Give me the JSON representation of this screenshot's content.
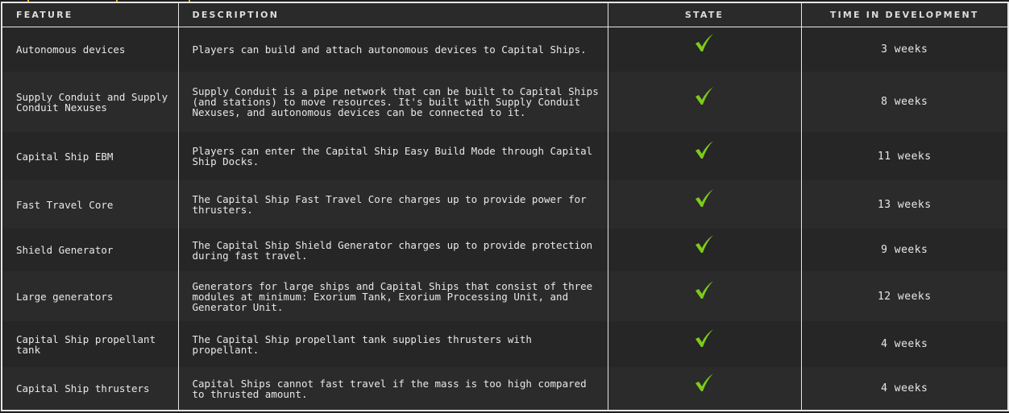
{
  "table": {
    "headers": {
      "feature": "Feature",
      "description": "Description",
      "state": "State",
      "time": "Time in Development"
    },
    "accent_check_color": "#7ccb1a",
    "rows": [
      {
        "feature": "Autonomous devices",
        "description": "Players can build and attach autonomous devices to Capital Ships.",
        "state": "check-icon",
        "time": "3 weeks"
      },
      {
        "feature": "Supply Conduit and Supply Conduit Nexuses",
        "description": "Supply Conduit is a pipe network that can be built to Capital Ships (and stations) to move resources. It's built with Supply Conduit Nexuses, and autonomous devices can be connected to it.",
        "state": "check-icon",
        "time": "8 weeks"
      },
      {
        "feature": "Capital Ship EBM",
        "description": "Players can enter the Capital Ship Easy Build Mode through Capital Ship Docks.",
        "state": "check-icon",
        "time": "11 weeks"
      },
      {
        "feature": "Fast Travel Core",
        "description": "The Capital Ship Fast Travel Core charges up to provide power for thrusters.",
        "state": "check-icon",
        "time": "13 weeks"
      },
      {
        "feature": "Shield Generator",
        "description": "The Capital Ship Shield Generator charges up to provide protection during fast travel.",
        "state": "check-icon",
        "time": "9 weeks"
      },
      {
        "feature": "Large generators",
        "description": "Generators for large ships and Capital Ships that consist of three modules at minimum: Exorium Tank, Exorium Processing Unit, and Generator Unit.",
        "state": "check-icon",
        "time": "12 weeks"
      },
      {
        "feature": "Capital Ship propellant tank",
        "description": "The Capital Ship propellant tank supplies thrusters with propellant.",
        "state": "check-icon",
        "time": "4 weeks"
      },
      {
        "feature": "Capital Ship thrusters",
        "description": "Capital Ships cannot fast travel if the mass is too high compared to thrusted amount.",
        "state": "check-icon",
        "time": "4 weeks"
      }
    ]
  }
}
